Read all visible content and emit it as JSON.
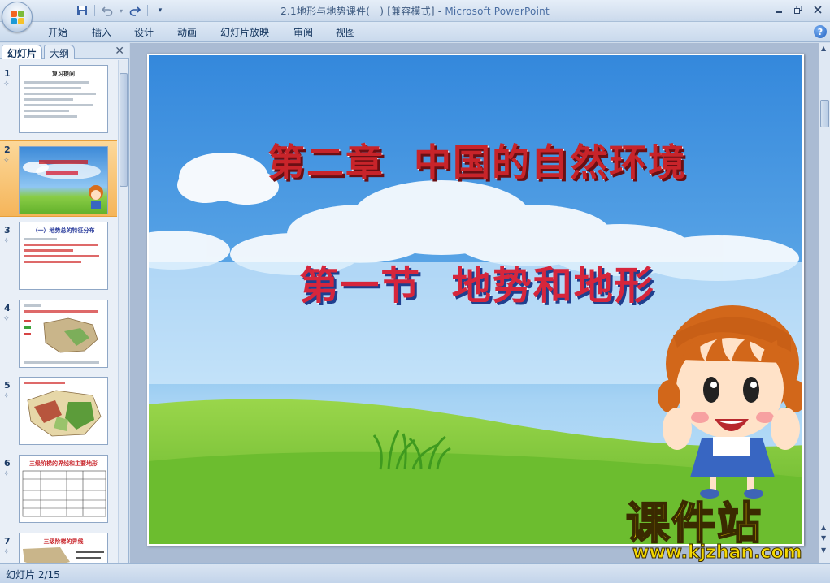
{
  "window": {
    "title": "2.1地形与地势课件(一) [兼容模式]",
    "app_name": "Microsoft PowerPoint",
    "title_separator": " - "
  },
  "quick_access": {
    "icons": [
      "save-icon",
      "undo-icon",
      "redo-icon",
      "customize-icon"
    ]
  },
  "ribbon": {
    "tabs": [
      "开始",
      "插入",
      "设计",
      "动画",
      "幻灯片放映",
      "审阅",
      "视图"
    ]
  },
  "left_pane": {
    "tabs": [
      "幻灯片",
      "大纲"
    ],
    "active_tab": "幻灯片",
    "selected_slide": 2,
    "slides": [
      {
        "number": "1",
        "title": "复习提问"
      },
      {
        "number": "2",
        "title": ""
      },
      {
        "number": "3",
        "title": "（一）地势总的特征分布"
      },
      {
        "number": "4",
        "title": ""
      },
      {
        "number": "5",
        "title": ""
      },
      {
        "number": "6",
        "title": "三级阶梯的界线和主要地形"
      },
      {
        "number": "7",
        "title": "三级阶梯的界线"
      }
    ]
  },
  "slide": {
    "title_line1": "第二章  中国的自然环境",
    "title_line2": "第一节  地势和地形",
    "title1_color": "#c8242a",
    "title2_color": "#d6263c",
    "sky_color": "#3b8ede",
    "grass_color": "#7ec832"
  },
  "status": {
    "slide_indicator": "幻灯片 2/15"
  },
  "watermark": {
    "text": "课件站",
    "url": "www.kjzhan.com"
  }
}
